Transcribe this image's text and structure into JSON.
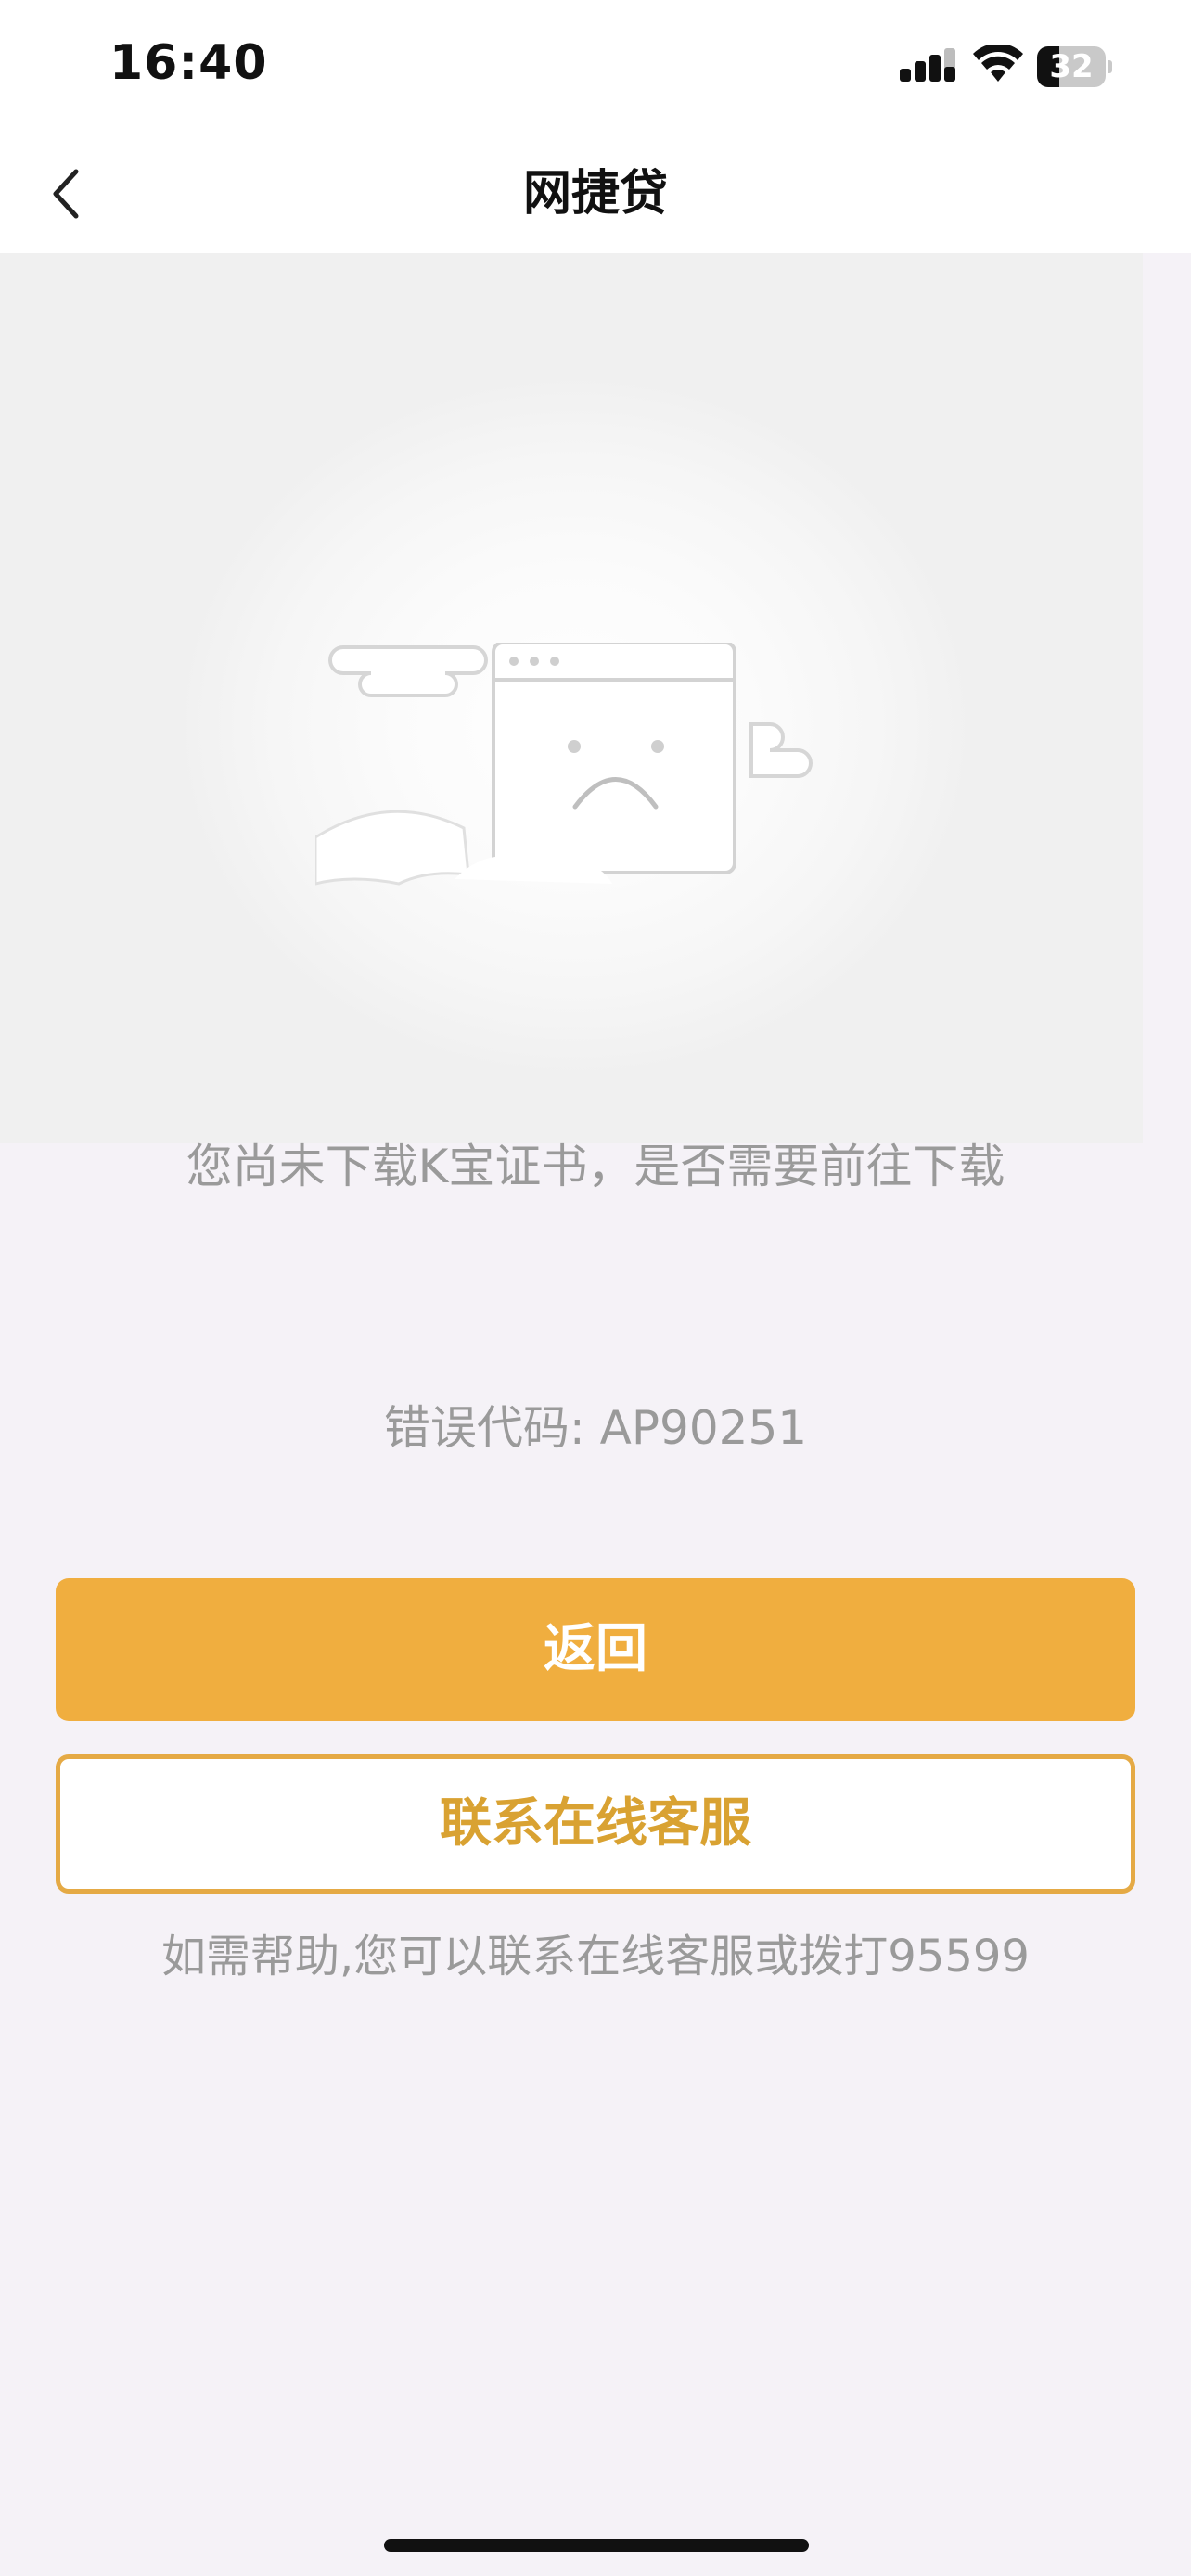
{
  "status_bar": {
    "time": "16:40",
    "battery_level": "32"
  },
  "nav": {
    "title": "网捷贷"
  },
  "content": {
    "message": "您尚未下载K宝证书，是否需要前往下载",
    "error_code": "错误代码: AP90251",
    "return_label": "返回",
    "service_label": "联系在线客服",
    "help_text": "如需帮助,您可以联系在线客服或拨打95599"
  },
  "colors": {
    "primary": "#f0ae3f",
    "outline": "#e5aa45",
    "muted_text": "#9a9a9a"
  }
}
